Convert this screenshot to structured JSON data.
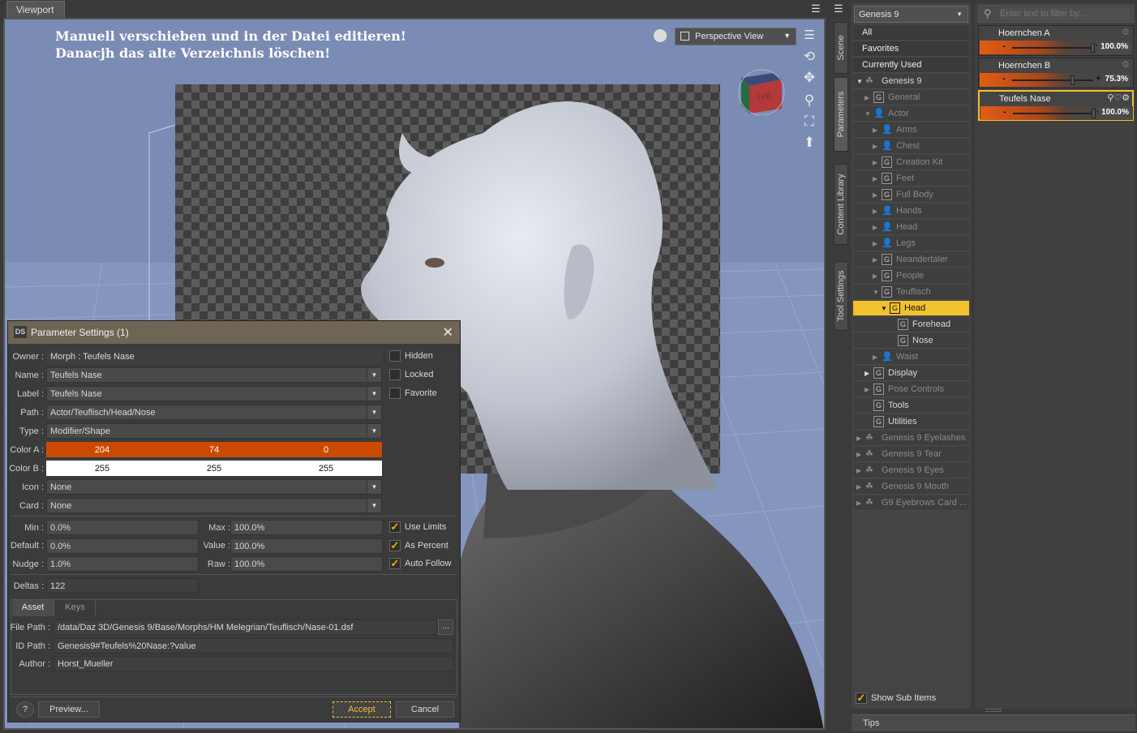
{
  "viewport": {
    "tab_label": "Viewport",
    "note_line1": "Manuell verschieben und in der Datei editieren!",
    "note_line2": "Danacjh das alte Verzeichnis löschen!",
    "view_select": "Perspective View",
    "cube_face": "Left"
  },
  "dialog": {
    "title": "Parameter Settings (1)",
    "logo": "DS",
    "owner_label": "Owner :",
    "owner_value": "Morph : Teufels Nase",
    "name_label": "Name :",
    "name_value": "Teufels Nase",
    "label_label": "Label :",
    "label_value": "Teufels Nase",
    "path_label": "Path :",
    "path_value": "Actor/Teuflisch/Head/Nose",
    "type_label": "Type :",
    "type_value": "Modifier/Shape",
    "colora_label": "Color A :",
    "colora": [
      "204",
      "74",
      "0"
    ],
    "colora_hex": "#cc4a00",
    "colorb_label": "Color B :",
    "colorb": [
      "255",
      "255",
      "255"
    ],
    "icon_label": "Icon :",
    "icon_value": "None",
    "card_label": "Card :",
    "card_value": "None",
    "hidden": "Hidden",
    "locked": "Locked",
    "favorite": "Favorite",
    "min_label": "Min :",
    "min_value": "0.0%",
    "max_label": "Max :",
    "max_value": "100.0%",
    "default_label": "Default :",
    "default_value": "0.0%",
    "value_label": "Value :",
    "value_value": "100.0%",
    "nudge_label": "Nudge :",
    "nudge_value": "1.0%",
    "raw_label": "Raw :",
    "raw_value": "100.0%",
    "use_limits": "Use Limits",
    "as_percent": "As Percent",
    "auto_follow": "Auto Follow",
    "deltas_label": "Deltas :",
    "deltas_value": "122",
    "tab_asset": "Asset",
    "tab_keys": "Keys",
    "filepath_label": "File Path :",
    "filepath_value": "/data/Daz 3D/Genesis 9/Base/Morphs/HM Melegrian/Teuflisch/Nase-01.dsf",
    "browse": "...",
    "idpath_label": "ID Path :",
    "idpath_value": "Genesis9#Teufels%20Nase:?value",
    "author_label": "Author :",
    "author_value": "Horst_Mueller",
    "help": "?",
    "preview": "Preview...",
    "accept": "Accept",
    "cancel": "Cancel"
  },
  "sidetabs": [
    "Scene",
    "Parameters",
    "Content Library",
    "Tool Settings"
  ],
  "tree": {
    "figure_select": "Genesis 9",
    "all": "All",
    "favorites": "Favorites",
    "currently_used": "Currently Used",
    "items": [
      {
        "label": "Genesis 9"
      },
      {
        "label": "General"
      },
      {
        "label": "Actor"
      },
      {
        "label": "Arms"
      },
      {
        "label": "Chest"
      },
      {
        "label": "Creation Kit"
      },
      {
        "label": "Feet"
      },
      {
        "label": "Full Body"
      },
      {
        "label": "Hands"
      },
      {
        "label": "Head"
      },
      {
        "label": "Legs"
      },
      {
        "label": "Neandertaler"
      },
      {
        "label": "People"
      },
      {
        "label": "Teuflisch"
      },
      {
        "label": "Head"
      },
      {
        "label": "Forehead"
      },
      {
        "label": "Nose"
      },
      {
        "label": "Waist"
      },
      {
        "label": "Display"
      },
      {
        "label": "Pose Controls"
      },
      {
        "label": "Tools"
      },
      {
        "label": "Utilities"
      },
      {
        "label": "Genesis 9 Eyelashes"
      },
      {
        "label": "Genesis 9 Tear"
      },
      {
        "label": "Genesis 9 Eyes"
      },
      {
        "label": "Genesis 9 Mouth"
      },
      {
        "label": "G9 Eyebrows Card ..."
      }
    ],
    "show_sub_items": "Show Sub Items"
  },
  "params": {
    "filter_placeholder": "Enter text to filter by...",
    "sliders": [
      {
        "name": "Hoernchen A",
        "value": "100.0%",
        "fraction": 1.0
      },
      {
        "name": "Hoernchen B",
        "value": "75.3%",
        "fraction": 0.753
      },
      {
        "name": "Teufels Nase",
        "value": "100.0%",
        "fraction": 1.0
      }
    ]
  },
  "bottom": {
    "tips": "Tips"
  },
  "colors": {
    "accent": "#f2c12e",
    "slider_orange": "#e35c12"
  }
}
